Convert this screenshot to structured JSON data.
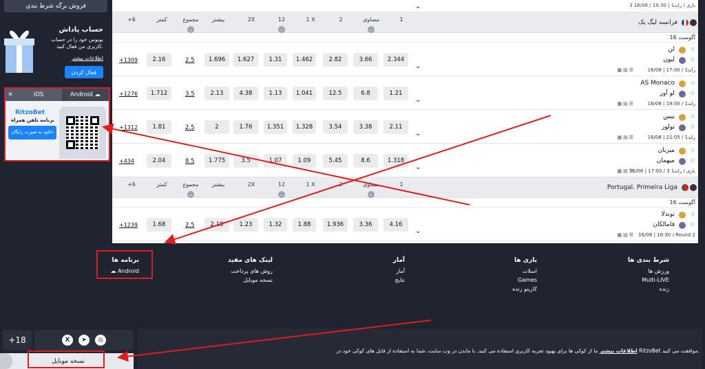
{
  "sidebar": {
    "sell_button": "فروش برگه شرط بندی",
    "bonus_title": "حساب پاداش",
    "bonus_text": "بونوس خود را در حساب کاربری من فعال کنید.",
    "bonus_more": "اطلاعات بیشتر",
    "bonus_activate": "فعال کردن",
    "app_tab_android": "Android",
    "app_tab_ios": "iOS",
    "app_logo": "RitzoBet",
    "app_mobile": "برنامه تلفن همراه",
    "app_download": "دانلود به صورت رایگان"
  },
  "top_row": {
    "meta": "3 بازی / راند1 | 19:30 / 16/08"
  },
  "leagues": [
    {
      "name": "فرانسه لیگ یک",
      "headers": [
        "1",
        "مساوی",
        "2",
        "1 X",
        "12",
        "2X",
        "بیشتر",
        "مجموع",
        "کمتر",
        "+6"
      ],
      "date": "16 آگوست",
      "matches": [
        {
          "team1": "لن",
          "team2": "لیون",
          "meta": "16/08 | 17:00 / راند1",
          "odds": [
            "2.344",
            "3.66",
            "2.82",
            "1.462",
            "1.31",
            "1.627",
            "1.696",
            "2.5",
            "2.16"
          ],
          "more": "+1309"
        },
        {
          "team1": "AS Monaco",
          "team2": "لو آور",
          "meta": "16/08 | 19:00 / راند1",
          "odds": [
            "1.21",
            "6.8",
            "12.5",
            "1.041",
            "1.13",
            "4.38",
            "2.13",
            "3.5",
            "1.712"
          ],
          "more": "+1276"
        },
        {
          "team1": "نیس",
          "team2": "تولوز",
          "meta": "16/08 | 21:05 / راند1",
          "odds": [
            "2.11",
            "3.38",
            "3.54",
            "1.328",
            "1.351",
            "1.76",
            "2",
            "2.5",
            "1.81"
          ],
          "more": "+1312"
        },
        {
          "team1": "میزبان",
          "team2": "میهمان",
          "meta": "16/08 | 17:00 / 3 بازی / راند1",
          "odds": [
            "1.318",
            "8.6",
            "5.45",
            "1.09",
            "1.07",
            "3.5",
            "1.775",
            "8.5",
            "2.04"
          ],
          "more": "+434"
        }
      ]
    },
    {
      "name": "Portugal. Primeira Liga",
      "headers": [
        "1",
        "مساوی",
        "2",
        "1 X",
        "12",
        "2X",
        "بیشتر",
        "مجموع",
        "کمتر",
        "+6"
      ],
      "date": "16 آگوست",
      "matches": [
        {
          "team1": "توندلا",
          "team2": "فامالکان",
          "meta": "16/08 | 16:30 / Round 2",
          "odds": [
            "4.16",
            "3.36",
            "1.936",
            "1.88",
            "1.32",
            "1.23",
            "2.18",
            "2.5",
            "1.68"
          ],
          "more": "+1239"
        }
      ]
    }
  ],
  "footer": {
    "col1": {
      "title": "شرط بندی ها",
      "items": [
        "ورزش ها",
        "Multi-LIVE",
        "زنده"
      ]
    },
    "col2": {
      "title": "بازی ها",
      "items": [
        "اسلات",
        "Games",
        "کازینو زنده"
      ]
    },
    "col3": {
      "title": "آمار",
      "items": [
        "آمار",
        "نتایج"
      ]
    },
    "col4": {
      "title": "لینک های مفید",
      "items": [
        "روش های پرداخت",
        "نسخه موبایل"
      ]
    },
    "col5": {
      "title": "برنامه ها",
      "items": [
        "Android"
      ]
    }
  },
  "bottom": {
    "age": "+18",
    "mobile_version": "نسخه موبایل",
    "cookie_text": "ما از کوکی ها برای بهبود تجربه کاربری استفاده می کنید. با ماندن در وب سایت، شما به استفاده از فایل های کوکی خود در RitzoBet موافقت می کنید.",
    "cookie_link": "اطلاعات بیشتر"
  },
  "colors": {
    "accent": "#1c83ff",
    "annotation": "#e21b1b",
    "dark": "#1f2430"
  }
}
